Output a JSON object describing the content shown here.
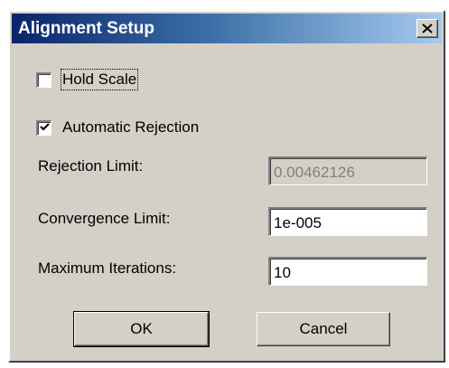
{
  "window": {
    "title": "Alignment Setup",
    "close_icon": "close-icon"
  },
  "options": {
    "hold_scale": {
      "label": "Hold Scale",
      "checked": false
    },
    "automatic_rejection": {
      "label": "Automatic Rejection",
      "checked": true
    }
  },
  "fields": {
    "rejection_limit": {
      "label": "Rejection Limit:",
      "value": "0.00462126",
      "disabled": true
    },
    "convergence_limit": {
      "label": "Convergence Limit:",
      "value": "1e-005"
    },
    "maximum_iterations": {
      "label": "Maximum Iterations:",
      "value": "10"
    }
  },
  "buttons": {
    "ok_label": "OK",
    "cancel_label": "Cancel"
  },
  "colors": {
    "dialog_face": "#d4d0c8",
    "title_start": "#0a246a",
    "title_end": "#a6caf0",
    "disabled_text": "#808080"
  }
}
